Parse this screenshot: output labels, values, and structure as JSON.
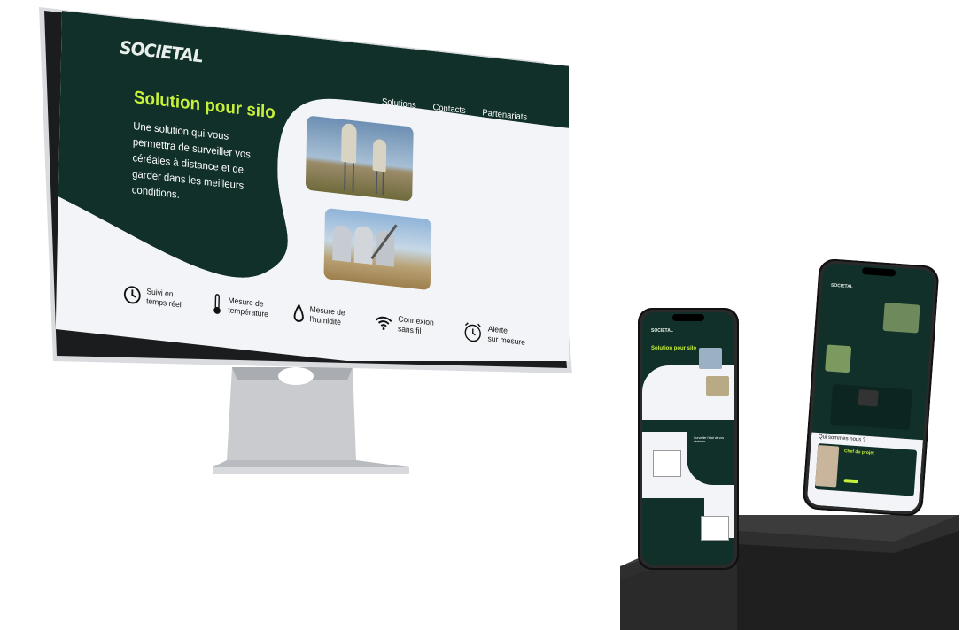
{
  "desktop": {
    "logo": "SOCIETAL",
    "nav": [
      "Solutions",
      "Contacts",
      "Partenariats"
    ],
    "hero": {
      "title": "Solution pour silo",
      "subtitle": "Une solution qui vous permettra de surveiller vos céréales à distance et de garder dans les meilleurs conditions."
    },
    "features": [
      {
        "icon": "clock-icon",
        "label": "Suivi en\ntemps réel"
      },
      {
        "icon": "thermometer-icon",
        "label": "Mesure de\ntempérature"
      },
      {
        "icon": "drop-icon",
        "label": "Mesure de\nl'humidité"
      },
      {
        "icon": "wifi-icon",
        "label": "Connexion\nsans fil"
      },
      {
        "icon": "alarm-clock-icon",
        "label": "Alerte\nsur mesure"
      }
    ]
  },
  "phone_left": {
    "logo": "SOCIETAL",
    "title": "Solution pour silo",
    "section_title": "Surveiller l'état de vos céréales"
  },
  "phone_right": {
    "logo": "SOCIETAL",
    "section_title": "Qui sommes nous ?",
    "chef_title": "Chef du projet"
  },
  "colors": {
    "dark_green": "#11302a",
    "accent_lime": "#c6f03a",
    "light_bg": "#f2f4f7"
  }
}
